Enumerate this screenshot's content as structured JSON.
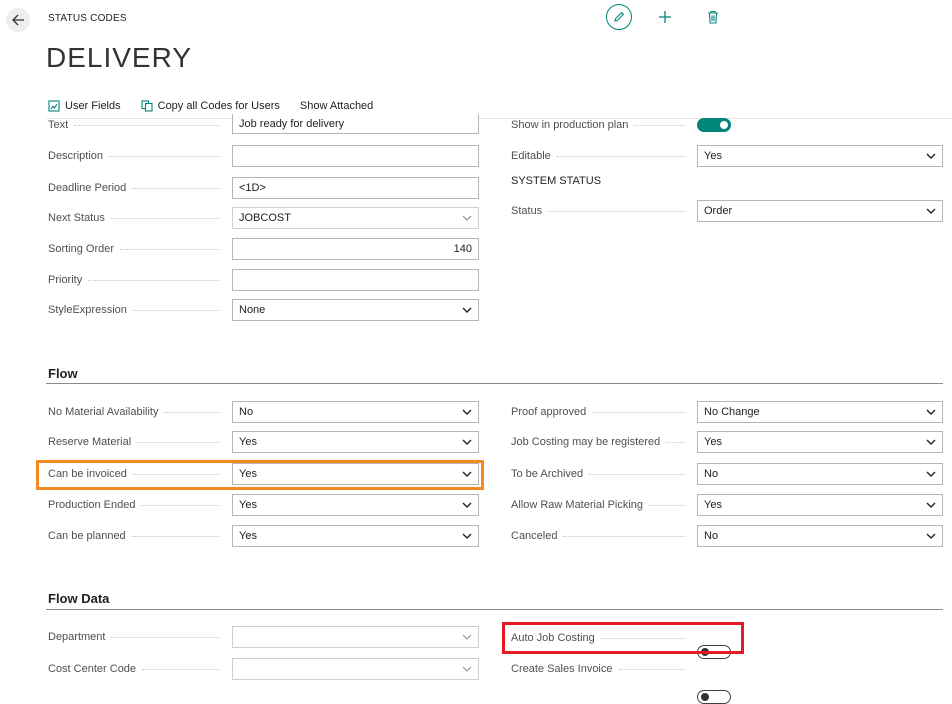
{
  "header": {
    "caption": "STATUS CODES",
    "title": "DELIVERY"
  },
  "actions": [
    "User Fields",
    "Copy all Codes for Users",
    "Show Attached"
  ],
  "general_left": [
    {
      "label": "Text",
      "value": "Job ready for delivery",
      "kind": "input"
    },
    {
      "label": "Description",
      "value": "",
      "kind": "input"
    },
    {
      "label": "Deadline Period",
      "value": "<1D>",
      "kind": "input"
    },
    {
      "label": "Next Status",
      "value": "JOBCOST",
      "kind": "lookup"
    },
    {
      "label": "Sorting Order",
      "value": "140",
      "kind": "number"
    },
    {
      "label": "Priority",
      "value": "",
      "kind": "input"
    },
    {
      "label": "StyleExpression",
      "value": "None",
      "kind": "select"
    }
  ],
  "general_right": {
    "show_in_plan_label": "Show in production plan",
    "show_in_plan": true,
    "editable_label": "Editable",
    "editable_value": "Yes",
    "system_status_heading": "SYSTEM STATUS",
    "status_label": "Status",
    "status_value": "Order"
  },
  "flow": {
    "title": "Flow",
    "left": [
      {
        "label": "No Material Availability",
        "value": "No"
      },
      {
        "label": "Reserve Material",
        "value": "Yes"
      },
      {
        "label": "Can be invoiced",
        "value": "Yes"
      },
      {
        "label": "Production Ended",
        "value": "Yes"
      },
      {
        "label": "Can be planned",
        "value": "Yes"
      }
    ],
    "right": [
      {
        "label": "Proof approved",
        "value": "No Change"
      },
      {
        "label": "Job Costing may be registered",
        "value": "Yes"
      },
      {
        "label": "To be Archived",
        "value": "No"
      },
      {
        "label": "Allow Raw Material Picking",
        "value": "Yes"
      },
      {
        "label": "Canceled",
        "value": "No"
      }
    ]
  },
  "flow_data": {
    "title": "Flow Data",
    "left": [
      {
        "label": "Department",
        "value": ""
      },
      {
        "label": "Cost Center Code",
        "value": ""
      }
    ],
    "right": [
      {
        "label": "Auto Job Costing",
        "on": false
      },
      {
        "label": "Create Sales Invoice",
        "on": false
      }
    ]
  },
  "colors": {
    "accent": "#00857a",
    "highlight_orange": "#f28a22",
    "highlight_red": "#e41b23"
  }
}
